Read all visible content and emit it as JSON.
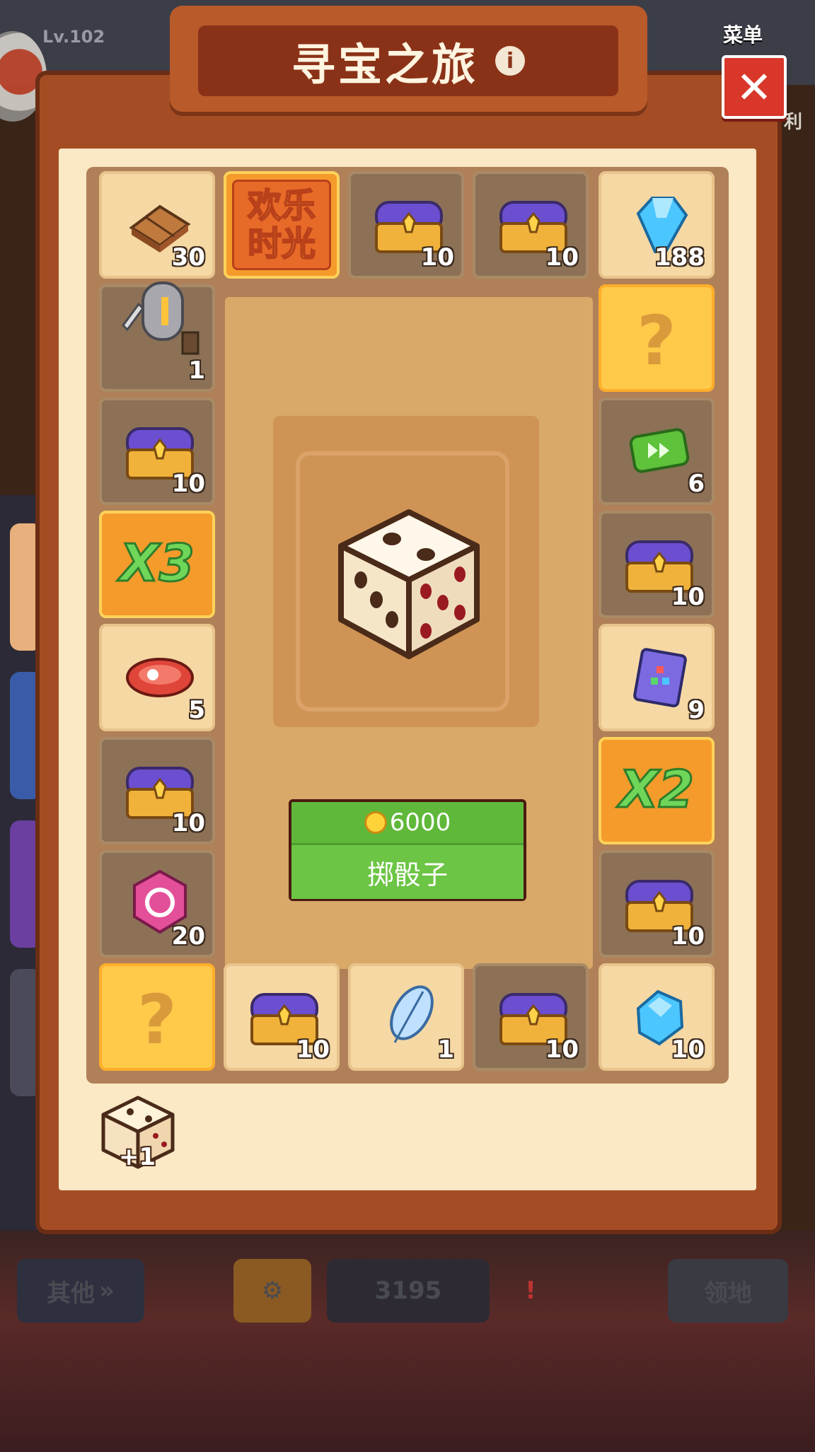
{
  "background": {
    "level": "Lv.102",
    "menu_label": "菜单",
    "side_label": "利",
    "bottom_bar": {
      "other_label": "其他",
      "counter": "3195",
      "claim_label": "领地"
    }
  },
  "dialog": {
    "title": "寻宝之旅",
    "info_icon": "info-icon",
    "close_icon": "close-icon"
  },
  "board": {
    "happy_time": [
      "欢乐",
      "时光"
    ],
    "tiles": {
      "t_wood": "30",
      "t_chest1": "10",
      "t_chest2": "10",
      "t_gem_top": "188",
      "t_knight": "1",
      "t_chest_left1": "10",
      "t_x3": "X3",
      "t_meat": "5",
      "t_chest_left2": "10",
      "t_pink": "20",
      "t_chest_bot1": "10",
      "t_feather": "1",
      "t_chest_bot2": "10",
      "t_gem_bot": "10",
      "t_ff": "6",
      "t_chest_right1": "10",
      "t_book": "9",
      "t_x2": "X2",
      "t_chest_right2": "10",
      "q_mark": "?"
    }
  },
  "roll": {
    "cost": "6000",
    "label": "掷骰子"
  },
  "bonus_dice": "+1",
  "colors": {
    "panel": "#a44d24",
    "inner": "#fbe8c5",
    "button_green": "#5fb83a",
    "close_red": "#d8372a"
  }
}
